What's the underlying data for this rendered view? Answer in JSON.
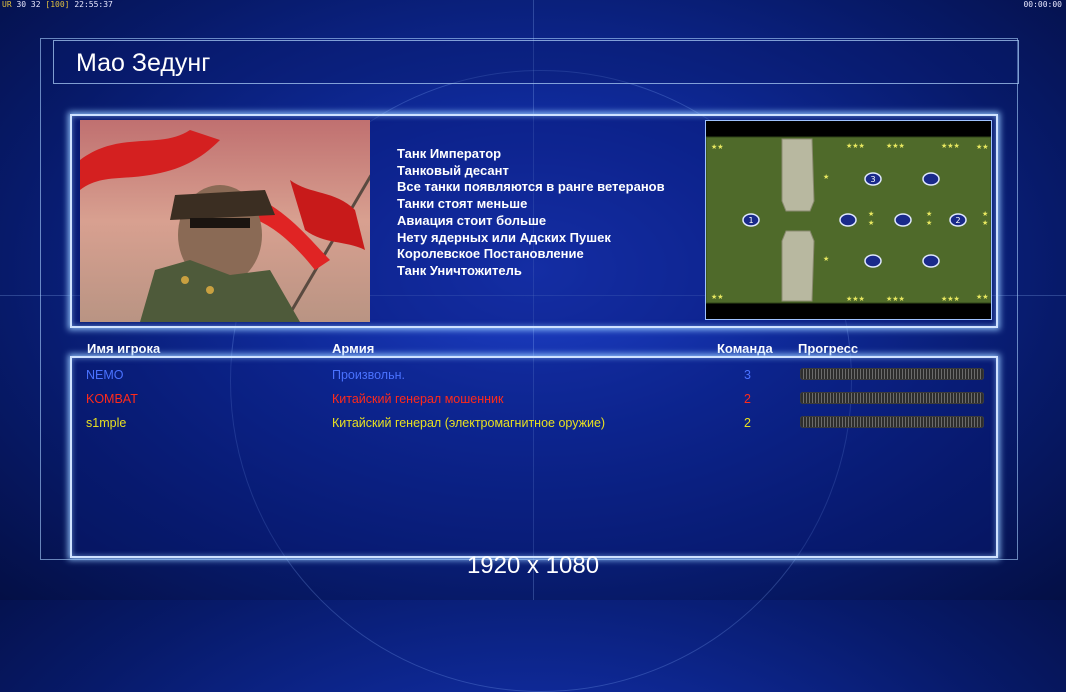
{
  "topbar": {
    "fps_label": "UR",
    "stats": "30 32",
    "fps_limit": "[100]",
    "clock": "22:55:37",
    "timer": "00:00:00"
  },
  "title": "Мао Зедунг",
  "rules": [
    "Танк Император",
    "Танковый десант",
    "Все танки появляются в ранге ветеранов",
    "Танки стоят меньше",
    "Авиация стоит больше",
    "Нету ядерных или Адских Пушек",
    "Королевское Постановление",
    "Танк Уничтожитель"
  ],
  "minimap": {
    "start_positions": [
      "1",
      "2",
      "3"
    ]
  },
  "table": {
    "headers": {
      "player": "Имя игрока",
      "army": "Армия",
      "team": "Команда",
      "progress": "Прогресс"
    },
    "rows": [
      {
        "name": "NEMO",
        "army": "Произвольн.",
        "team": "3",
        "color": "#4a72ff",
        "progress": 1.0
      },
      {
        "name": "KOMBAT",
        "army": "Китайский генерал мошенник",
        "team": "2",
        "color": "#ff2a1a",
        "progress": 1.0
      },
      {
        "name": "s1mple",
        "army": "Китайский генерал (электромагнитное оружие)",
        "team": "2",
        "color": "#e8e020",
        "progress": 1.0
      }
    ]
  },
  "resolution": "1920 x 1080",
  "colors": {
    "background": "#0f2a9a",
    "panel_border": "#cfe2ff",
    "minimap_ground": "#4f6a2a"
  }
}
